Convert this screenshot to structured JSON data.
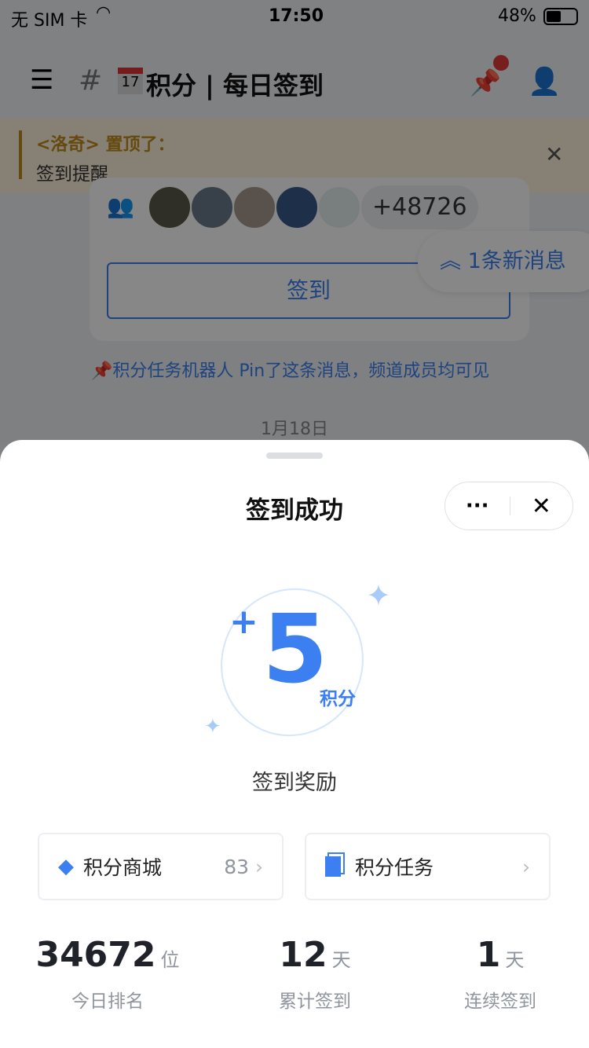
{
  "status": {
    "carrier": "无 SIM 卡",
    "time": "17:50",
    "battery": "48%"
  },
  "header": {
    "title": "积分 | 每日签到",
    "calendar_day": "17",
    "hash": "#"
  },
  "pin": {
    "who": "<洛奇> 置顶了：",
    "text": "签到提醒"
  },
  "chat": {
    "member_more": "+48726",
    "signin_button": "签到",
    "new_messages": "1条新消息",
    "pinned_note": "积分任务机器人 Pin了这条消息，频道成员均可见",
    "date": "1月18日"
  },
  "sheet": {
    "title": "签到成功",
    "reward_prefix": "+",
    "reward_value": "5",
    "reward_unit": "积分",
    "reward_label": "签到奖励",
    "shop": {
      "label": "积分商城",
      "count": "83"
    },
    "tasks": {
      "label": "积分任务"
    },
    "stats": [
      {
        "value": "34672",
        "unit": "位",
        "label": "今日排名"
      },
      {
        "value": "12",
        "unit": "天",
        "label": "累计签到"
      },
      {
        "value": "1",
        "unit": "天",
        "label": "连续签到"
      }
    ]
  },
  "colors": {
    "accent": "#3b7ff0",
    "pin_text": "#c08a1e"
  }
}
